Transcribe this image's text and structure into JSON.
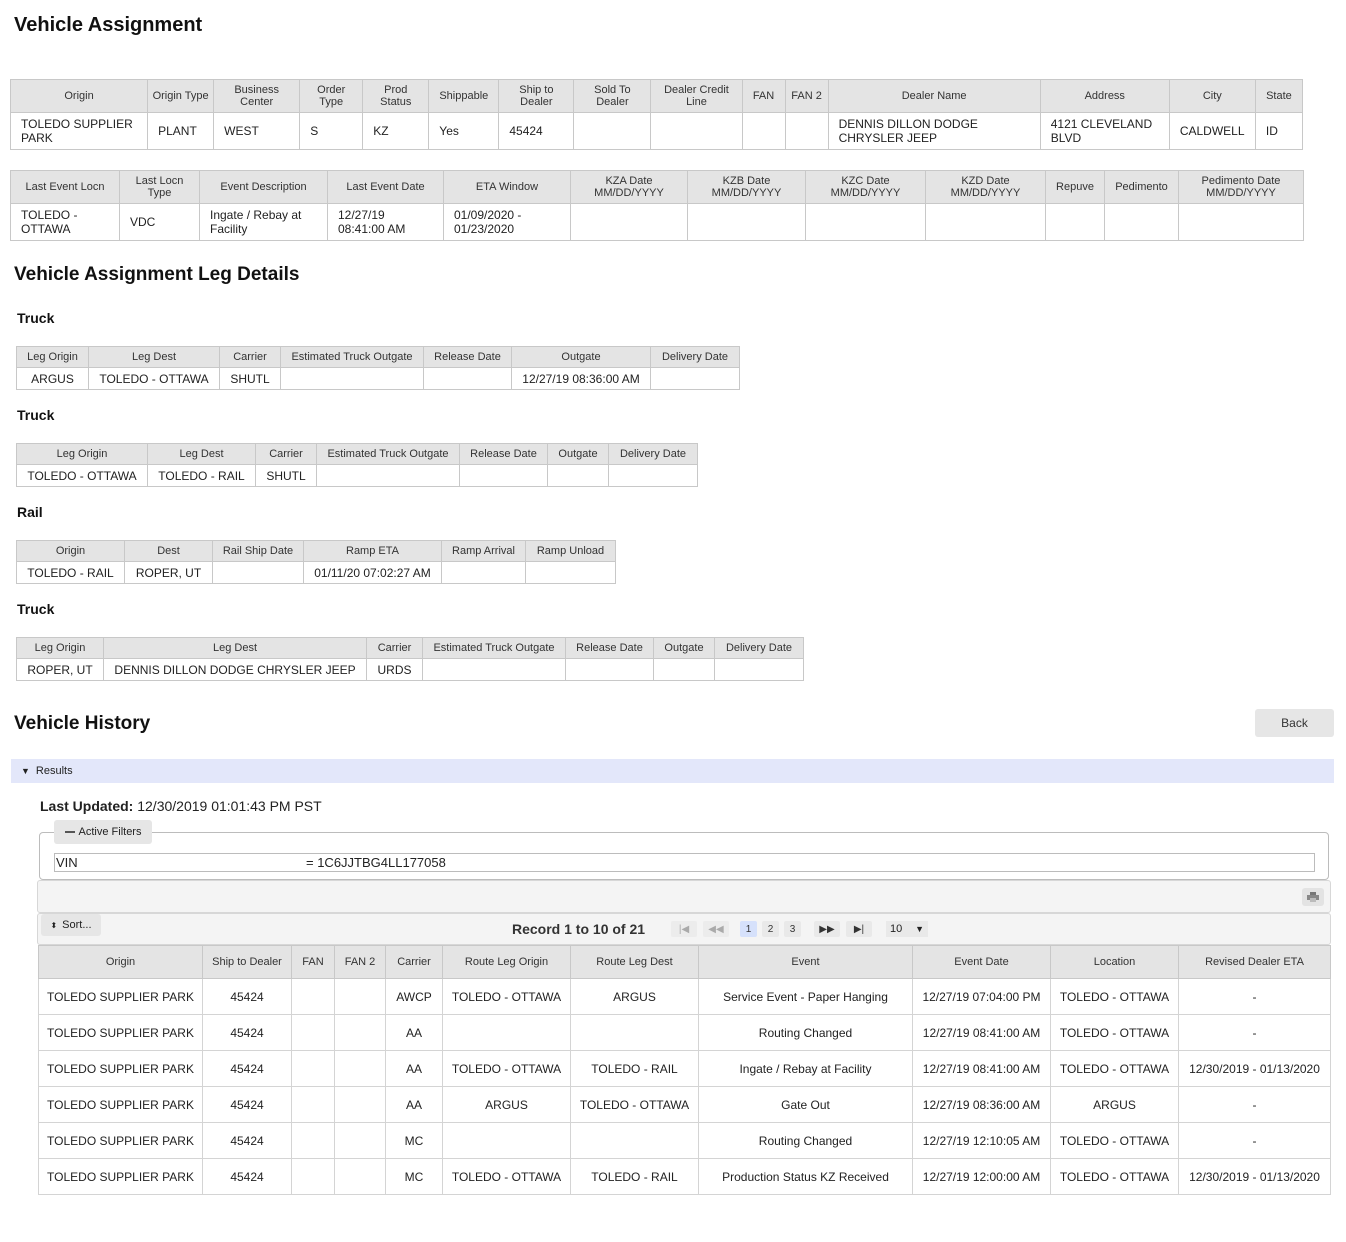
{
  "page_title": "Vehicle Assignment",
  "assignment_table": {
    "headers": [
      "Origin",
      "Origin Type",
      "Business Center",
      "Order Type",
      "Prod Status",
      "Shippable",
      "Ship to Dealer",
      "Sold To Dealer",
      "Dealer Credit Line",
      "FAN",
      "FAN 2",
      "Dealer Name",
      "Address",
      "City",
      "State"
    ],
    "row": [
      "TOLEDO SUPPLIER PARK",
      "PLANT",
      "WEST",
      "S",
      "KZ",
      "Yes",
      "45424",
      "",
      "",
      "",
      "",
      "DENNIS DILLON DODGE CHRYSLER JEEP",
      "4121 CLEVELAND BLVD",
      "CALDWELL",
      "ID"
    ]
  },
  "event_table": {
    "headers": [
      "Last Event Locn",
      "Last Locn Type",
      "Event Description",
      "Last Event Date",
      "ETA Window",
      "KZA Date MM/DD/YYYY",
      "KZB Date MM/DD/YYYY",
      "KZC Date MM/DD/YYYY",
      "KZD Date MM/DD/YYYY",
      "Repuve",
      "Pedimento",
      "Pedimento Date MM/DD/YYYY"
    ],
    "row": [
      "TOLEDO - OTTAWA",
      "VDC",
      "Ingate / Rebay at Facility",
      "12/27/19 08:41:00 AM",
      "01/09/2020 - 01/23/2020",
      "",
      "",
      "",
      "",
      "",
      "",
      ""
    ]
  },
  "leg_details_title": "Vehicle Assignment Leg Details",
  "legs": [
    {
      "label": "Truck",
      "headers": [
        "Leg Origin",
        "Leg Dest",
        "Carrier",
        "Estimated Truck Outgate",
        "Release Date",
        "Outgate",
        "Delivery Date"
      ],
      "row": [
        "ARGUS",
        "TOLEDO - OTTAWA",
        "SHUTL",
        "",
        "",
        "12/27/19 08:36:00 AM",
        ""
      ]
    },
    {
      "label": "Truck",
      "headers": [
        "Leg Origin",
        "Leg Dest",
        "Carrier",
        "Estimated Truck Outgate",
        "Release Date",
        "Outgate",
        "Delivery Date"
      ],
      "row": [
        "TOLEDO - OTTAWA",
        "TOLEDO - RAIL",
        "SHUTL",
        "",
        "",
        "",
        ""
      ]
    },
    {
      "label": "Rail",
      "headers": [
        "Origin",
        "Dest",
        "Rail Ship Date",
        "Ramp ETA",
        "Ramp Arrival",
        "Ramp Unload"
      ],
      "row": [
        "TOLEDO - RAIL",
        "ROPER, UT",
        "",
        "01/11/20 07:02:27 AM",
        "",
        ""
      ]
    },
    {
      "label": "Truck",
      "headers": [
        "Leg Origin",
        "Leg Dest",
        "Carrier",
        "Estimated Truck Outgate",
        "Release Date",
        "Outgate",
        "Delivery Date"
      ],
      "row": [
        "ROPER, UT",
        "DENNIS DILLON DODGE CHRYSLER JEEP",
        "URDS",
        "",
        "",
        "",
        ""
      ]
    }
  ],
  "history": {
    "title": "Vehicle History",
    "back_label": "Back",
    "results_label": "Results",
    "last_updated_label": "Last Updated:",
    "last_updated_value": "12/30/2019 01:01:43 PM PST",
    "active_filters_label": "Active Filters",
    "filter_key": "VIN",
    "filter_value": "= 1C6JJTBG4LL177058",
    "sort_label": "Sort...",
    "record_text": "Record 1 to 10 of 21",
    "pager": {
      "first": "|◀",
      "prev": "◀◀",
      "pages": [
        "1",
        "2",
        "3"
      ],
      "current_page": "1",
      "next": "▶▶",
      "last": "▶|",
      "page_size": "10"
    },
    "headers": [
      "Origin",
      "Ship to Dealer",
      "FAN",
      "FAN 2",
      "Carrier",
      "Route Leg Origin",
      "Route Leg Dest",
      "Event",
      "Event Date",
      "Location",
      "Revised Dealer ETA"
    ],
    "rows": [
      [
        "TOLEDO SUPPLIER PARK",
        "45424",
        "",
        "",
        "AWCP",
        "TOLEDO - OTTAWA",
        "ARGUS",
        "Service Event - Paper Hanging",
        "12/27/19 07:04:00 PM",
        "TOLEDO - OTTAWA",
        "-"
      ],
      [
        "TOLEDO SUPPLIER PARK",
        "45424",
        "",
        "",
        "AA",
        "",
        "",
        "Routing Changed",
        "12/27/19 08:41:00 AM",
        "TOLEDO - OTTAWA",
        "-"
      ],
      [
        "TOLEDO SUPPLIER PARK",
        "45424",
        "",
        "",
        "AA",
        "TOLEDO - OTTAWA",
        "TOLEDO - RAIL",
        "Ingate / Rebay at Facility",
        "12/27/19 08:41:00 AM",
        "TOLEDO - OTTAWA",
        "12/30/2019 - 01/13/2020"
      ],
      [
        "TOLEDO SUPPLIER PARK",
        "45424",
        "",
        "",
        "AA",
        "ARGUS",
        "TOLEDO - OTTAWA",
        "Gate Out",
        "12/27/19 08:36:00 AM",
        "ARGUS",
        "-"
      ],
      [
        "TOLEDO SUPPLIER PARK",
        "45424",
        "",
        "",
        "MC",
        "",
        "",
        "Routing Changed",
        "12/27/19 12:10:05 AM",
        "TOLEDO - OTTAWA",
        "-"
      ],
      [
        "TOLEDO SUPPLIER PARK",
        "45424",
        "",
        "",
        "MC",
        "TOLEDO - OTTAWA",
        "TOLEDO - RAIL",
        "Production Status KZ Received",
        "12/27/19 12:00:00 AM",
        "TOLEDO - OTTAWA",
        "12/30/2019 - 01/13/2020"
      ]
    ]
  }
}
